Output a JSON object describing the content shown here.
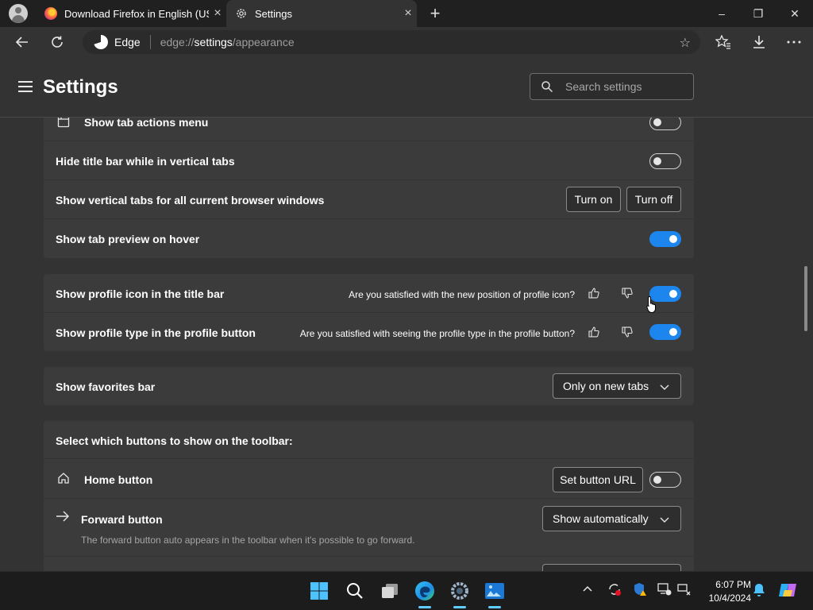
{
  "browser": {
    "tabs": [
      {
        "title": "Download Firefox in English (US)",
        "icon": "firefox-icon",
        "close": "×"
      },
      {
        "title": "Settings",
        "icon": "gear-icon",
        "close": "×"
      }
    ],
    "new_tab": "+",
    "window_controls": {
      "minimize": "–",
      "restore": "❐",
      "close": "✕"
    },
    "address": {
      "brand": "Edge",
      "url_prefix": "edge://",
      "url_host": "settings",
      "url_path": "/appearance"
    }
  },
  "settings": {
    "title": "Settings",
    "search_placeholder": "Search settings",
    "cards": {
      "tabs": {
        "rows": [
          {
            "label": "Show tab actions menu",
            "toggle": "off"
          },
          {
            "label": "Hide title bar while in vertical tabs",
            "toggle": "off"
          },
          {
            "label": "Show vertical tabs for all current browser windows",
            "button_on": "Turn on",
            "button_off": "Turn off"
          },
          {
            "label": "Show tab preview on hover",
            "toggle": "on"
          }
        ]
      },
      "profile": {
        "rows": [
          {
            "label": "Show profile icon in the title bar",
            "question": "Are you satisfied with the new position of profile icon?",
            "toggle": "on"
          },
          {
            "label": "Show profile type in the profile button",
            "question": "Are you satisfied with seeing the profile type in the profile button?",
            "toggle": "on"
          }
        ]
      },
      "favorites": {
        "label": "Show favorites bar",
        "selected": "Only on new tabs"
      },
      "toolbar_buttons": {
        "heading": "Select which buttons to show on the toolbar:",
        "home": {
          "label": "Home button",
          "button": "Set button URL",
          "toggle": "off"
        },
        "forward": {
          "label": "Forward button",
          "selected": "Show automatically",
          "description": "The forward button auto appears in the toolbar when it's possible to go forward."
        }
      }
    }
  },
  "taskbar": {
    "clock_time": "6:07 PM",
    "clock_date": "10/4/2024",
    "apps": [
      "windows-start-icon",
      "search-icon",
      "task-view-icon",
      "edge-icon",
      "settings-icon",
      "photos-icon"
    ]
  },
  "colors": {
    "accent": "#1c86ee",
    "background": "#333333",
    "card": "#3b3b3b",
    "tabstrip": "#202020"
  }
}
